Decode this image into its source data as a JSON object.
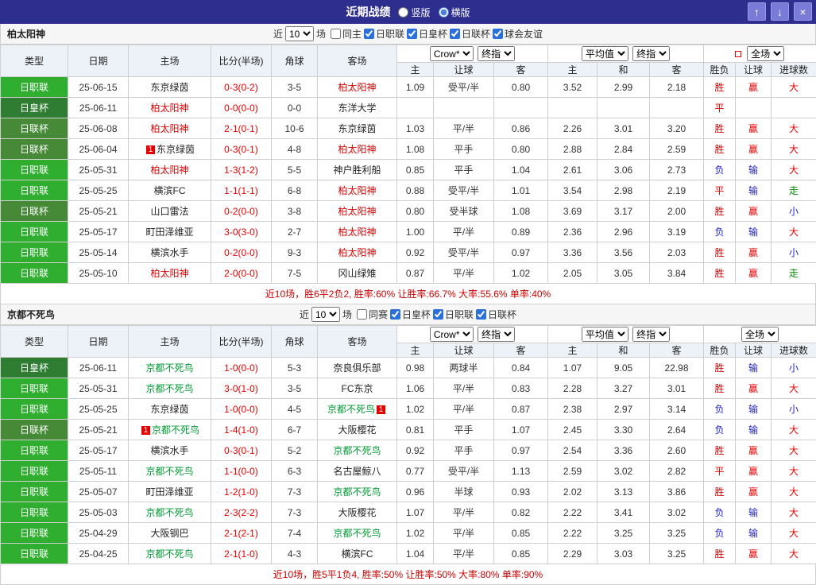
{
  "titlebar": {
    "title": "近期战绩",
    "radio_vertical": "竖版",
    "radio_horizontal": "横版",
    "up": "↑",
    "down": "↓",
    "close": "×"
  },
  "filter_labels": {
    "near": "近",
    "games": "场"
  },
  "selects": {
    "near_count": "10",
    "bookmaker": "Crow*",
    "final": "终指",
    "average": "平均值",
    "fullmatch": "全场"
  },
  "table_header": {
    "type": "类型",
    "date": "日期",
    "home": "主场",
    "score": "比分(半场)",
    "corner": "角球",
    "away": "客场",
    "sub": [
      "主",
      "让球",
      "客",
      "主",
      "和",
      "客",
      "胜负",
      "让球",
      "进球数"
    ]
  },
  "league_colors": {
    "日职联": "#2fae2f",
    "日皇杯": "#2e7d32",
    "日联杯": "#468a38"
  },
  "result_colors": {
    "胜": "#e60000",
    "平": "#e60000",
    "负": "#2222cc",
    "赢": "#e60000",
    "输": "#2222cc",
    "大": "#e60000",
    "小": "#2222cc",
    "走": "#0a8a0a"
  },
  "sections": [
    {
      "team": "柏太阳神",
      "team_color": "#dd0000",
      "filter": {
        "checkboxes": [
          {
            "label": "同主",
            "checked": false
          },
          {
            "label": "日职联",
            "checked": true
          },
          {
            "label": "日皇杯",
            "checked": true
          },
          {
            "label": "日联杯",
            "checked": true
          },
          {
            "label": "球会友谊",
            "checked": true
          }
        ]
      },
      "rows": [
        {
          "lg": "日职联",
          "date": "25-06-15",
          "home": "东京绿茵",
          "hf": false,
          "score": "0-3(0-2)",
          "corner": "3-5",
          "away": "柏太阳神",
          "af": true,
          "odds": [
            "1.09",
            "受平/半",
            "0.80",
            "3.52",
            "2.99",
            "2.18"
          ],
          "res": [
            "胜",
            "赢",
            "大"
          ]
        },
        {
          "lg": "日皇杯",
          "date": "25-06-11",
          "home": "柏太阳神",
          "hf": true,
          "score": "0-0(0-0)",
          "corner": "0-0",
          "away": "东洋大学",
          "af": false,
          "odds": [
            "",
            "",
            "",
            "",
            "",
            ""
          ],
          "res": [
            "平",
            "",
            ""
          ]
        },
        {
          "lg": "日联杯",
          "date": "25-06-08",
          "home": "柏太阳神",
          "hf": true,
          "score": "2-1(0-1)",
          "corner": "10-6",
          "away": "东京绿茵",
          "af": false,
          "odds": [
            "1.03",
            "平/半",
            "0.86",
            "2.26",
            "3.01",
            "3.20"
          ],
          "res": [
            "胜",
            "赢",
            "大"
          ]
        },
        {
          "lg": "日联杯",
          "date": "25-06-04",
          "home": "东京绿茵",
          "hf": false,
          "hpre": "1",
          "score": "0-3(0-1)",
          "corner": "4-8",
          "away": "柏太阳神",
          "af": true,
          "odds": [
            "1.08",
            "平手",
            "0.80",
            "2.88",
            "2.84",
            "2.59"
          ],
          "res": [
            "胜",
            "赢",
            "大"
          ]
        },
        {
          "lg": "日职联",
          "date": "25-05-31",
          "home": "柏太阳神",
          "hf": true,
          "score": "1-3(1-2)",
          "corner": "5-5",
          "away": "神户胜利船",
          "af": false,
          "odds": [
            "0.85",
            "平手",
            "1.04",
            "2.61",
            "3.06",
            "2.73"
          ],
          "res": [
            "负",
            "输",
            "大"
          ]
        },
        {
          "lg": "日职联",
          "date": "25-05-25",
          "home": "横滨FC",
          "hf": false,
          "score": "1-1(1-1)",
          "corner": "6-8",
          "away": "柏太阳神",
          "af": true,
          "odds": [
            "0.88",
            "受平/半",
            "1.01",
            "3.54",
            "2.98",
            "2.19"
          ],
          "res": [
            "平",
            "输",
            "走"
          ]
        },
        {
          "lg": "日联杯",
          "date": "25-05-21",
          "home": "山口雷法",
          "hf": false,
          "score": "0-2(0-0)",
          "corner": "3-8",
          "away": "柏太阳神",
          "af": true,
          "odds": [
            "0.80",
            "受半球",
            "1.08",
            "3.69",
            "3.17",
            "2.00"
          ],
          "res": [
            "胜",
            "赢",
            "小"
          ]
        },
        {
          "lg": "日职联",
          "date": "25-05-17",
          "home": "町田泽维亚",
          "hf": false,
          "score": "3-0(3-0)",
          "corner": "2-7",
          "away": "柏太阳神",
          "af": true,
          "odds": [
            "1.00",
            "平/半",
            "0.89",
            "2.36",
            "2.96",
            "3.19"
          ],
          "res": [
            "负",
            "输",
            "大"
          ]
        },
        {
          "lg": "日职联",
          "date": "25-05-14",
          "home": "横滨水手",
          "hf": false,
          "score": "0-2(0-0)",
          "corner": "9-3",
          "away": "柏太阳神",
          "af": true,
          "odds": [
            "0.92",
            "受平/半",
            "0.97",
            "3.36",
            "3.56",
            "2.03"
          ],
          "res": [
            "胜",
            "赢",
            "小"
          ]
        },
        {
          "lg": "日职联",
          "date": "25-05-10",
          "home": "柏太阳神",
          "hf": true,
          "score": "2-0(0-0)",
          "corner": "7-5",
          "away": "冈山绿雉",
          "af": false,
          "odds": [
            "0.87",
            "平/半",
            "1.02",
            "2.05",
            "3.05",
            "3.84"
          ],
          "res": [
            "胜",
            "赢",
            "走"
          ]
        }
      ],
      "summary": "近10场，胜6平2负2, 胜率:60% 让胜率:66.7% 大率:55.6% 单率:40%"
    },
    {
      "team": "京都不死鸟",
      "team_color": "#009933",
      "filter": {
        "checkboxes": [
          {
            "label": "同赛",
            "checked": false
          },
          {
            "label": "日皇杯",
            "checked": true
          },
          {
            "label": "日职联",
            "checked": true
          },
          {
            "label": "日联杯",
            "checked": true
          }
        ]
      },
      "rows": [
        {
          "lg": "日皇杯",
          "date": "25-06-11",
          "home": "京都不死鸟",
          "hf": true,
          "score": "1-0(0-0)",
          "corner": "5-3",
          "away": "奈良俱乐部",
          "af": false,
          "odds": [
            "0.98",
            "两球半",
            "0.84",
            "1.07",
            "9.05",
            "22.98"
          ],
          "res": [
            "胜",
            "输",
            "小"
          ]
        },
        {
          "lg": "日职联",
          "date": "25-05-31",
          "home": "京都不死鸟",
          "hf": true,
          "score": "3-0(1-0)",
          "corner": "3-5",
          "away": "FC东京",
          "af": false,
          "odds": [
            "1.06",
            "平/半",
            "0.83",
            "2.28",
            "3.27",
            "3.01"
          ],
          "res": [
            "胜",
            "赢",
            "大"
          ]
        },
        {
          "lg": "日职联",
          "date": "25-05-25",
          "home": "东京绿茵",
          "hf": false,
          "score": "1-0(0-0)",
          "corner": "4-5",
          "away": "京都不死鸟",
          "af": true,
          "apost": "1",
          "odds": [
            "1.02",
            "平/半",
            "0.87",
            "2.38",
            "2.97",
            "3.14"
          ],
          "res": [
            "负",
            "输",
            "小"
          ]
        },
        {
          "lg": "日联杯",
          "date": "25-05-21",
          "home": "京都不死鸟",
          "hf": true,
          "hpre": "1",
          "score": "1-4(1-0)",
          "corner": "6-7",
          "away": "大阪樱花",
          "af": false,
          "odds": [
            "0.81",
            "平手",
            "1.07",
            "2.45",
            "3.30",
            "2.64"
          ],
          "res": [
            "负",
            "输",
            "大"
          ]
        },
        {
          "lg": "日职联",
          "date": "25-05-17",
          "home": "横滨水手",
          "hf": false,
          "score": "0-3(0-1)",
          "corner": "5-2",
          "away": "京都不死鸟",
          "af": true,
          "odds": [
            "0.92",
            "平手",
            "0.97",
            "2.54",
            "3.36",
            "2.60"
          ],
          "res": [
            "胜",
            "赢",
            "大"
          ]
        },
        {
          "lg": "日职联",
          "date": "25-05-11",
          "home": "京都不死鸟",
          "hf": true,
          "score": "1-1(0-0)",
          "corner": "6-3",
          "away": "名古屋鲸八",
          "af": false,
          "odds": [
            "0.77",
            "受平/半",
            "1.13",
            "2.59",
            "3.02",
            "2.82"
          ],
          "res": [
            "平",
            "赢",
            "大"
          ]
        },
        {
          "lg": "日职联",
          "date": "25-05-07",
          "home": "町田泽维亚",
          "hf": false,
          "score": "1-2(1-0)",
          "corner": "7-3",
          "away": "京都不死鸟",
          "af": true,
          "odds": [
            "0.96",
            "半球",
            "0.93",
            "2.02",
            "3.13",
            "3.86"
          ],
          "res": [
            "胜",
            "赢",
            "大"
          ]
        },
        {
          "lg": "日职联",
          "date": "25-05-03",
          "home": "京都不死鸟",
          "hf": true,
          "score": "2-3(2-2)",
          "corner": "7-3",
          "away": "大阪樱花",
          "af": false,
          "odds": [
            "1.07",
            "平/半",
            "0.82",
            "2.22",
            "3.41",
            "3.02"
          ],
          "res": [
            "负",
            "输",
            "大"
          ]
        },
        {
          "lg": "日职联",
          "date": "25-04-29",
          "home": "大阪钢巴",
          "hf": false,
          "score": "2-1(2-1)",
          "corner": "7-4",
          "away": "京都不死鸟",
          "af": true,
          "odds": [
            "1.02",
            "平/半",
            "0.85",
            "2.22",
            "3.25",
            "3.25"
          ],
          "res": [
            "负",
            "输",
            "大"
          ]
        },
        {
          "lg": "日职联",
          "date": "25-04-25",
          "home": "京都不死鸟",
          "hf": true,
          "score": "2-1(1-0)",
          "corner": "4-3",
          "away": "横滨FC",
          "af": false,
          "odds": [
            "1.04",
            "平/半",
            "0.85",
            "2.29",
            "3.03",
            "3.25"
          ],
          "res": [
            "胜",
            "赢",
            "大"
          ]
        }
      ],
      "summary": "近10场，胜5平1负4, 胜率:50% 让胜率:50% 大率:80% 单率:90%"
    }
  ]
}
